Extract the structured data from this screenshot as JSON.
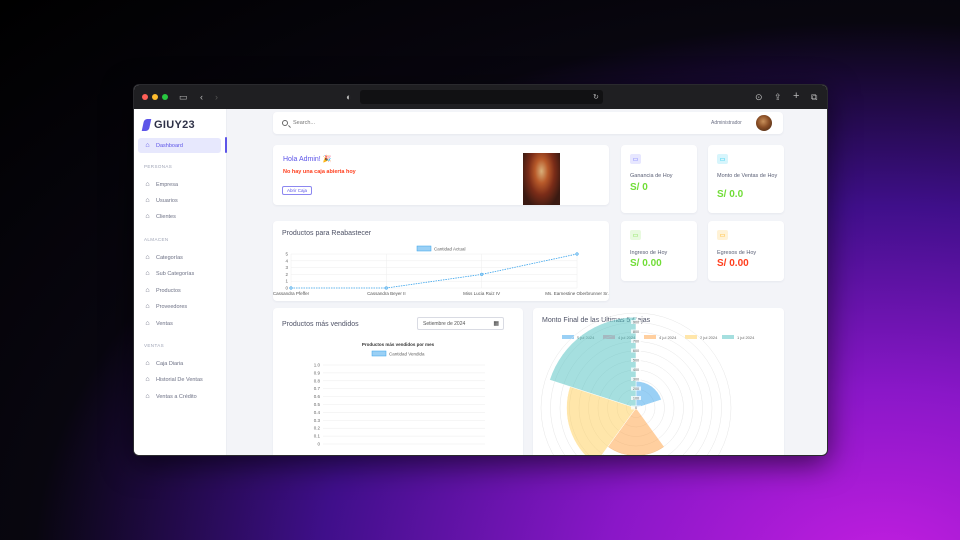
{
  "app": {
    "brand": "GIUY23",
    "logo_icon": "giuy23-logo-icon"
  },
  "sidebar": {
    "dashboard_label": "Dashboard",
    "sections": {
      "personas": "PERSONAS",
      "almacen": "ALMACEN",
      "ventas": "VENTAS"
    },
    "items": {
      "empresa": "Empresa",
      "usuarios": "Usuarios",
      "clientes": "Clientes",
      "categorias": "Categorías",
      "subcategorias": "Sub Categorías",
      "productos": "Productos",
      "proveedores": "Proveedores",
      "ventas": "Ventas",
      "caja_diaria": "Caja Diaria",
      "historial": "Historial De Ventas",
      "ventas_credito": "Ventas a Crédito"
    }
  },
  "topbar": {
    "search_placeholder": "Search...",
    "user_role": "Administrador"
  },
  "welcome": {
    "greeting": "Hola Admin! 🎉",
    "warning": "No hay una caja abierta hoy",
    "open_button": "Abrir Caja"
  },
  "metrics": {
    "ganancia": {
      "label": "Ganancia de Hoy",
      "value": "S/ 0",
      "color": "#71dd37",
      "icon": "wallet-icon",
      "icon_bg": "#e7e7ff",
      "icon_fg": "#696cff"
    },
    "monto": {
      "label": "Monto de Ventas de Hoy",
      "value": "S/ 0.0",
      "color": "#71dd37",
      "icon": "wallet-icon",
      "icon_bg": "#d7f5fc",
      "icon_fg": "#03c3ec"
    },
    "ingreso": {
      "label": "Ingreso de Hoy",
      "value": "S/ 0.00",
      "color": "#71dd37",
      "icon": "wallet-icon",
      "icon_bg": "#e8fadf",
      "icon_fg": "#71dd37"
    },
    "egreso": {
      "label": "Egresos de Hoy",
      "value": "S/ 0.00",
      "color": "#ff3e1d",
      "icon": "wallet-icon",
      "icon_bg": "#fff2d6",
      "icon_fg": "#ffab00"
    }
  },
  "restock": {
    "title": "Productos para Reabastecer",
    "chart_data": {
      "type": "line",
      "categories": [
        "Cassandra Pfeffer",
        "Cassandra Beyer II",
        "Miss Lucia Ruiz IV",
        "Ms. Earnestine Oberbrunner Sr."
      ],
      "series": [
        {
          "name": "Cantidad Actual",
          "values": [
            0,
            0,
            2,
            5
          ]
        }
      ],
      "ylim": [
        0,
        5
      ],
      "yticks": [
        "0",
        "1",
        "2",
        "3",
        "4",
        "5"
      ],
      "legend": "top",
      "color": "#36a2eb"
    }
  },
  "bestsellers": {
    "title": "Productos más vendidos",
    "month_value": "Setiembre de 2024",
    "chart_data": {
      "type": "bar",
      "title": "Productos más vendidos por mes",
      "series": [
        {
          "name": "Cantidad Vendida",
          "values": []
        }
      ],
      "categories": [],
      "ylim": [
        0,
        1
      ],
      "yticks": [
        "0",
        "0.1",
        "0.2",
        "0.3",
        "0.4",
        "0.5",
        "0.6",
        "0.7",
        "0.8",
        "0.9",
        "1.0"
      ],
      "legend": "top",
      "color": "#36a2eb"
    }
  },
  "cashbox": {
    "title": "Monto Final de las Ultimas 5 Cajas",
    "chart_data": {
      "type": "polarArea",
      "legend": "top",
      "series_names": [
        "5 jul 2024",
        "4 jul 2024",
        "4 jul 2024",
        "2 jul 2024",
        "1 jul 2024"
      ],
      "colors": [
        "#36a2eb",
        "#ff6384",
        "#ff9f40",
        "#ffcd56",
        "#4bc0c0"
      ],
      "values": [
        250,
        0,
        450,
        650,
        850
      ],
      "rticks": [
        "0",
        "100",
        "200",
        "300",
        "400",
        "500",
        "600",
        "700",
        "800",
        "900"
      ]
    }
  }
}
